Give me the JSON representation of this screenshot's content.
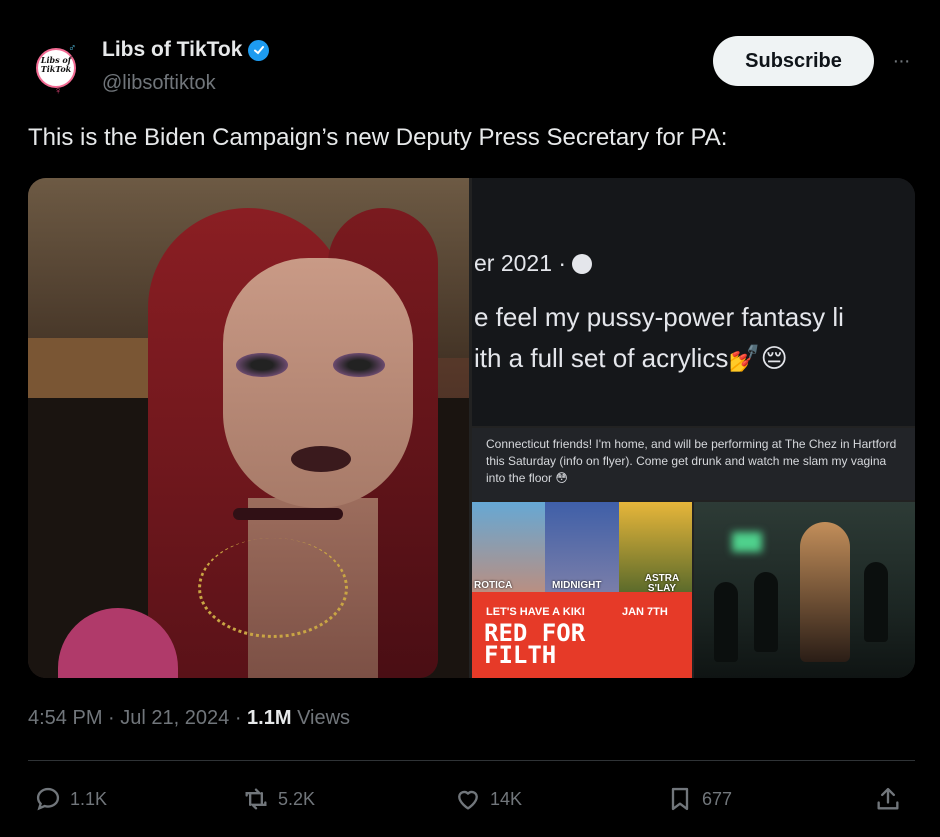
{
  "account": {
    "display_name": "Libs of TikTok",
    "handle": "@libsoftiktok",
    "avatar_text": "Libs of TikTok",
    "verified_color": "#1d9bf0"
  },
  "header": {
    "subscribe_label": "Subscribe",
    "more_label": "···"
  },
  "tweet": {
    "text": "This is the Biden Campaign’s new Deputy Press Secretary for PA:"
  },
  "media": {
    "post_date": "er 2021 ·",
    "post_line1": "e feel my pussy-power fantasy li",
    "post_line2": "ith a full set of acrylics💅😔",
    "mid_text": "Connecticut friends! I'm home, and will be performing at The Chez in Hartford this Saturday (info on flyer). Come get drunk and watch me slam my vagina into the floor 😳",
    "flyer": {
      "name1": "ROTICA",
      "name2": "MIDNIGHT",
      "name3": "ASTRA S'LAY",
      "tagline": "LET'S HAVE A KIKI",
      "date": "JAN 7TH",
      "title_line1": "RED FOR",
      "title_line2": "FILTH"
    }
  },
  "meta": {
    "time": "4:54 PM",
    "date": "Jul 21, 2024",
    "views_count": "1.1M",
    "views_label": "Views"
  },
  "actions": {
    "replies": "1.1K",
    "reposts": "5.2K",
    "likes": "14K",
    "bookmarks": "677"
  },
  "colors": {
    "background": "#000000",
    "text": "#e7e9ea",
    "muted": "#71767b",
    "accent": "#1d9bf0"
  }
}
